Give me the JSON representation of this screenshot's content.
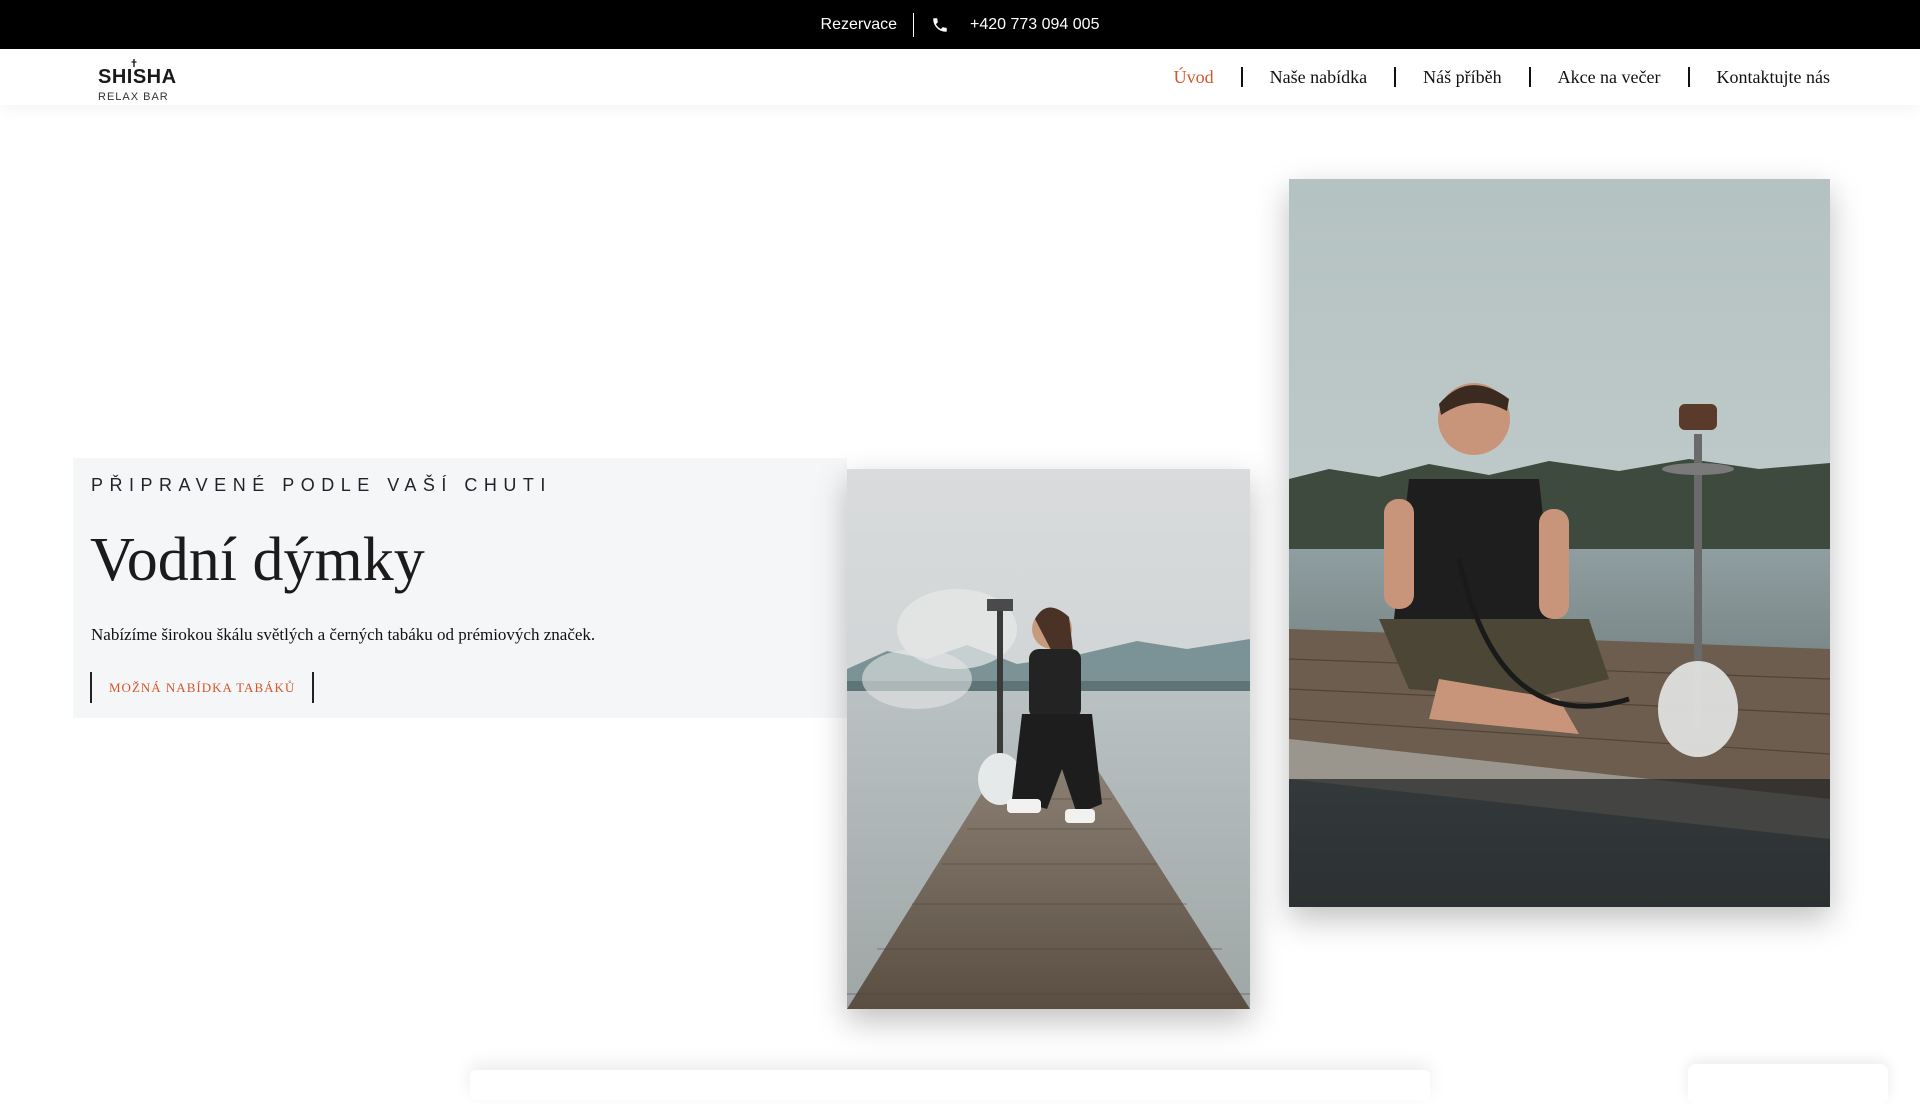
{
  "topbar": {
    "reservation_label": "Rezervace",
    "phone": "+420 773 094 005",
    "icon": "phone-icon"
  },
  "logo": {
    "main": "SHISHA",
    "sub": "RELAX BAR"
  },
  "nav": {
    "items": [
      {
        "label": "Úvod",
        "active": true
      },
      {
        "label": "Naše nabídka",
        "active": false
      },
      {
        "label": "Náš příběh",
        "active": false
      },
      {
        "label": "Akce na večer",
        "active": false
      },
      {
        "label": "Kontaktujte nás",
        "active": false
      }
    ]
  },
  "hero": {
    "eyebrow": "PŘIPRAVENÉ PODLE VAŠÍ CHUTI",
    "title": "Vodní dýmky",
    "description": "Nabízíme širokou škálu světlých a černých tabáku od prémiových značek.",
    "cta_label": "MOŽNÁ NABÍDKA TABÁKŮ"
  },
  "colors": {
    "accent": "#d4572a",
    "topbar_bg": "#000000",
    "panel_bg": "#f5f6f8",
    "text": "#111111"
  }
}
